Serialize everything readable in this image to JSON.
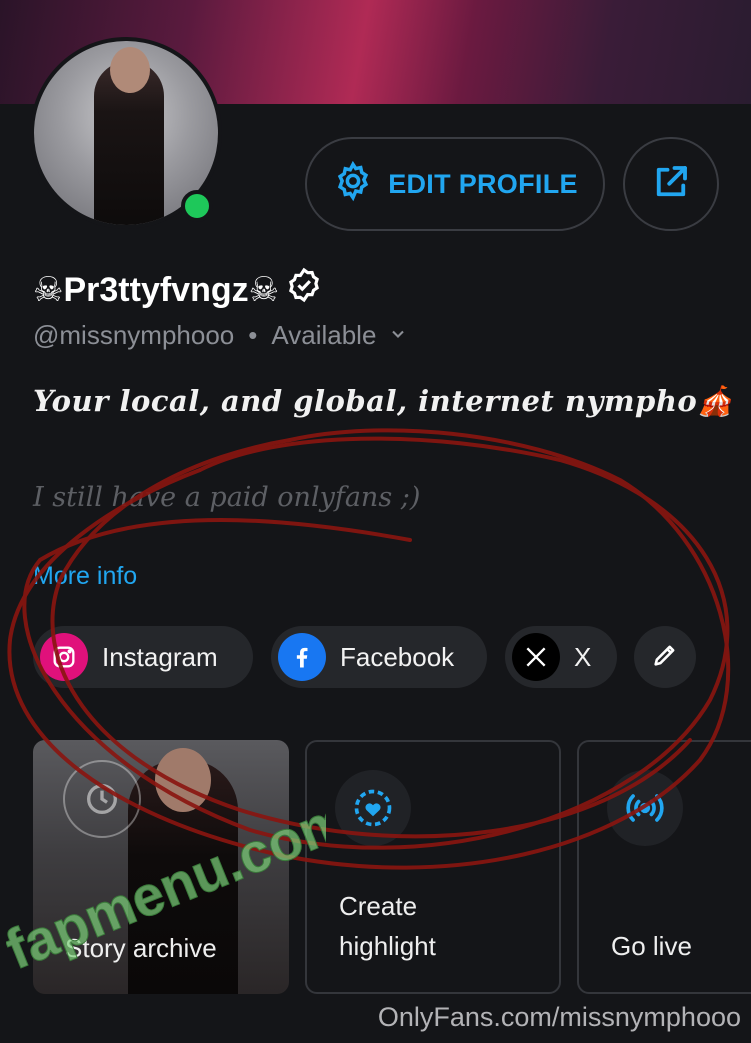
{
  "profile": {
    "display_name": "☠Pr3ttyfvngz☠",
    "handle": "@missnymphooo",
    "status": "Available",
    "bio_line1": "Your local, and global, internet nympho🎪",
    "bio_line2": "I still have a paid onlyfans ;)",
    "more_info": "More info"
  },
  "actions": {
    "edit_profile": "EDIT PROFILE"
  },
  "socials": [
    {
      "label": "Instagram",
      "icon": "instagram-icon",
      "color": "#e0117b"
    },
    {
      "label": "Facebook",
      "icon": "facebook-icon",
      "color": "#1877f2"
    },
    {
      "label": "X",
      "icon": "x-icon",
      "color": "#000000"
    }
  ],
  "cards": {
    "story_archive": "Story archive",
    "create_highlight": "Create highlight",
    "go_live": "Go live"
  },
  "watermark": "fapmenu.com",
  "footer": "OnlyFans.com/missnymphooo",
  "colors": {
    "accent": "#21a6f0",
    "online": "#1ec85a",
    "background": "#141518"
  }
}
